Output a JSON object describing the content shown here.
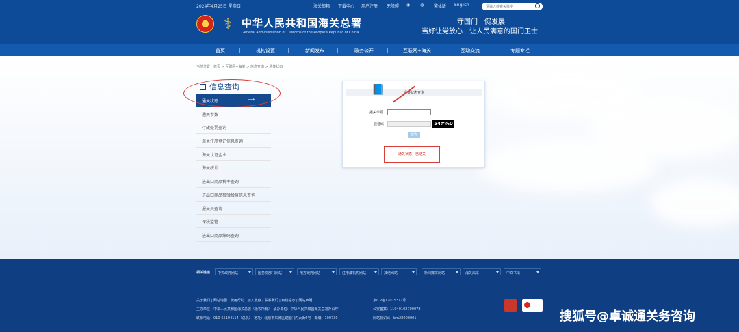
{
  "topbar": {
    "date": "2024年4月25日 星期四",
    "links": [
      "海关邮箱",
      "下载中心",
      "用户注册",
      "无障碍",
      "繁体版",
      "English"
    ],
    "search_placeholder": "请输入搜索关键字"
  },
  "header": {
    "title_cn": "中华人民共和国海关总署",
    "title_en": "General Administration of Customs of the People's Republic of China",
    "slogan1": "守国门　促发展",
    "slogan2": "当好让党放心　让人民满意的国门卫士"
  },
  "nav": [
    "首页",
    "机构设置",
    "新闻发布",
    "政务公开",
    "互联网+海关",
    "互动交流",
    "专题专栏"
  ],
  "breadcrumb": "当前位置：首页 > 互联网+海关 > 信息查询 > 通关状态",
  "sidebar": {
    "title": "信息查询",
    "items": [
      "通关状态",
      "通关参数",
      "行政处罚查询",
      "海关注册登记信息查询",
      "海关认证企业",
      "海关统计",
      "进出口商品税率查询",
      "进出口商品检验检疫信息查询",
      "报关员查询",
      "保税监管",
      "进出口商品编码查询"
    ]
  },
  "panel": {
    "title": "通关状态查询",
    "field1": "报关单号",
    "field2": "验证码",
    "captcha": "54#%0",
    "button": "查询",
    "status": "通关状态：已结关"
  },
  "footer": {
    "related": "相关链接",
    "selects": [
      "中央政府网站",
      "国务院部门网站",
      "地方政府网站",
      "驻港澳机构网站",
      "其他网站",
      "新闻媒体网站",
      "海关风采",
      "中文书法"
    ],
    "row1": [
      "关于我们",
      "网站地图",
      "使用帮助",
      "加入收藏",
      "联系我们",
      "纠错提示",
      "网站声明"
    ],
    "icp": "京ICP备17015317号",
    "sponsor": "主办单位：中华人民共和国海关总署（版权所有）　承办单位：中华人民共和国海关总署办公厅",
    "address": "联系电话：010-65194114（总机）　地址：北京市东城区建国门内大街6号　邮编：100730",
    "police": "公安备案：11040102700078",
    "website_id": "网站标识码：bm28000001"
  },
  "watermark": "搜狐号@卓诚通关务咨询"
}
